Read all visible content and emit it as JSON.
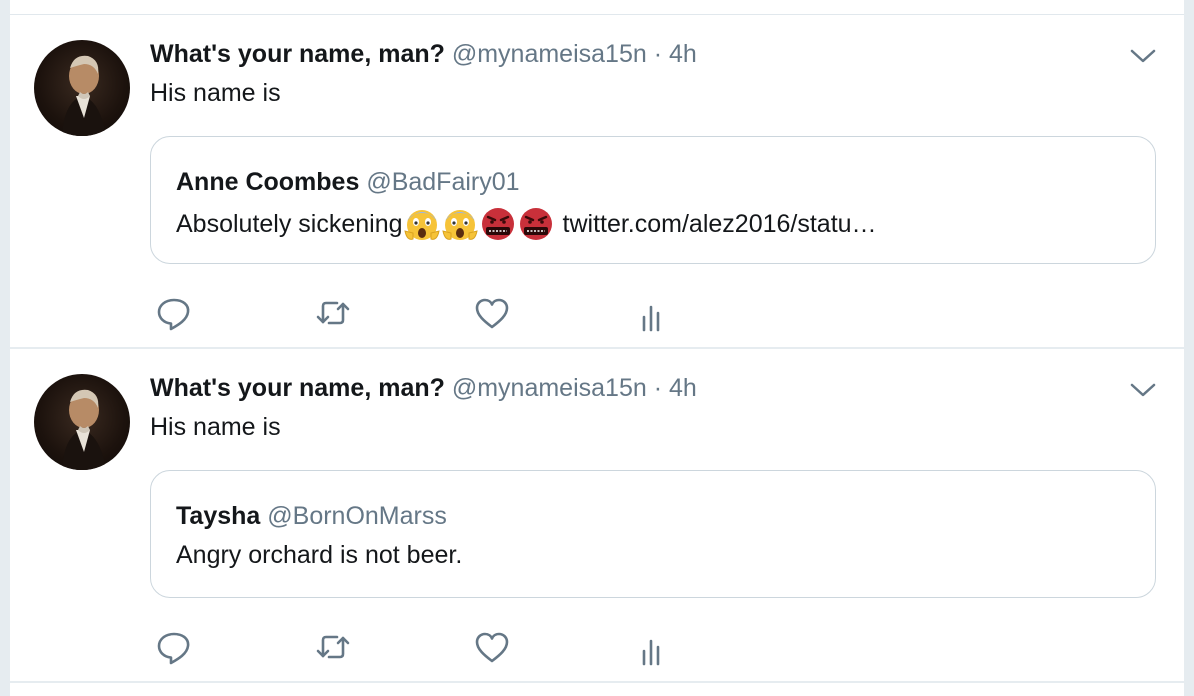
{
  "tweets": [
    {
      "author_name": "What's your name, man?",
      "author_handle": "@mynameisa15n",
      "separator": "·",
      "time": "4h",
      "text": "His name is",
      "quoted": {
        "name": "Anne Coombes",
        "handle": "@BadFairy01",
        "text": "Absolutely sickening",
        "emojis": [
          "face-screaming-in-fear-icon",
          "face-screaming-in-fear-icon",
          "face-with-symbols-on-mouth-icon",
          "face-with-symbols-on-mouth-icon"
        ],
        "link": "twitter.com/alez2016/statu…"
      }
    },
    {
      "author_name": "What's your name, man?",
      "author_handle": "@mynameisa15n",
      "separator": "·",
      "time": "4h",
      "text": "His name is",
      "quoted": {
        "name": "Taysha",
        "handle": "@BornOnMarss",
        "text": "Angry orchard is not beer."
      }
    }
  ],
  "icons": {
    "caret": "chevron-down-icon",
    "reply": "reply-icon",
    "retweet": "retweet-icon",
    "like": "heart-icon",
    "analytics": "analytics-icon"
  },
  "colors": {
    "background": "#e6ecf0",
    "card": "#ffffff",
    "secondary_text": "#657786",
    "icon": "#657786",
    "border": "#ccd6dd"
  }
}
